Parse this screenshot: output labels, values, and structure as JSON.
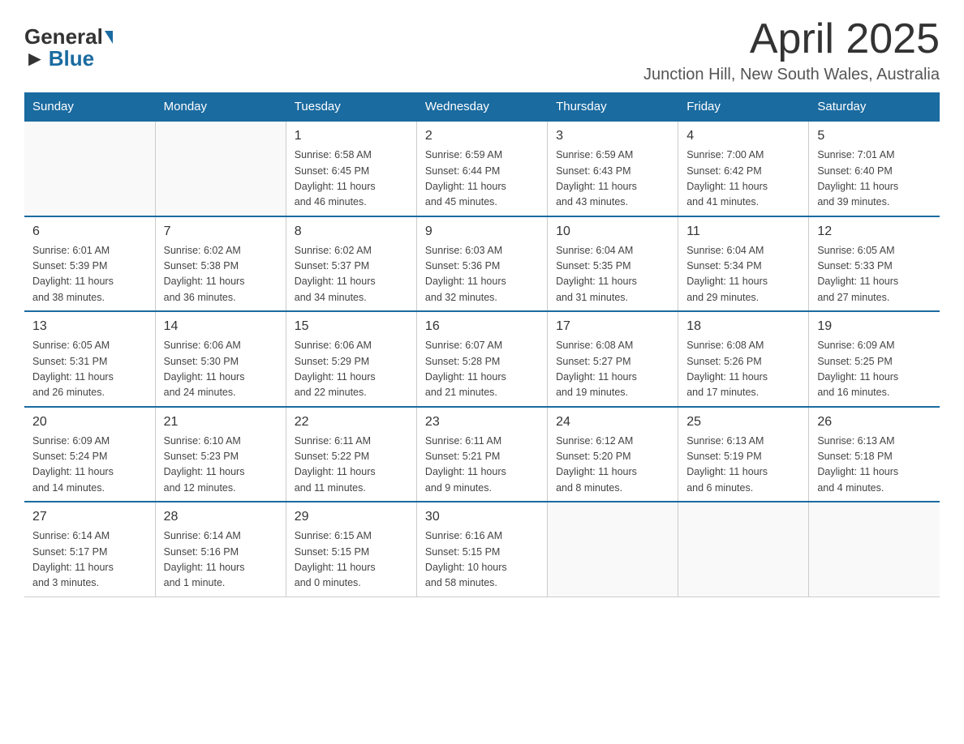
{
  "header": {
    "title": "April 2025",
    "subtitle": "Junction Hill, New South Wales, Australia"
  },
  "logo": {
    "part1": "General",
    "part2": "Blue"
  },
  "days_of_week": [
    "Sunday",
    "Monday",
    "Tuesday",
    "Wednesday",
    "Thursday",
    "Friday",
    "Saturday"
  ],
  "weeks": [
    [
      {
        "day": "",
        "info": ""
      },
      {
        "day": "",
        "info": ""
      },
      {
        "day": "1",
        "info": "Sunrise: 6:58 AM\nSunset: 6:45 PM\nDaylight: 11 hours\nand 46 minutes."
      },
      {
        "day": "2",
        "info": "Sunrise: 6:59 AM\nSunset: 6:44 PM\nDaylight: 11 hours\nand 45 minutes."
      },
      {
        "day": "3",
        "info": "Sunrise: 6:59 AM\nSunset: 6:43 PM\nDaylight: 11 hours\nand 43 minutes."
      },
      {
        "day": "4",
        "info": "Sunrise: 7:00 AM\nSunset: 6:42 PM\nDaylight: 11 hours\nand 41 minutes."
      },
      {
        "day": "5",
        "info": "Sunrise: 7:01 AM\nSunset: 6:40 PM\nDaylight: 11 hours\nand 39 minutes."
      }
    ],
    [
      {
        "day": "6",
        "info": "Sunrise: 6:01 AM\nSunset: 5:39 PM\nDaylight: 11 hours\nand 38 minutes."
      },
      {
        "day": "7",
        "info": "Sunrise: 6:02 AM\nSunset: 5:38 PM\nDaylight: 11 hours\nand 36 minutes."
      },
      {
        "day": "8",
        "info": "Sunrise: 6:02 AM\nSunset: 5:37 PM\nDaylight: 11 hours\nand 34 minutes."
      },
      {
        "day": "9",
        "info": "Sunrise: 6:03 AM\nSunset: 5:36 PM\nDaylight: 11 hours\nand 32 minutes."
      },
      {
        "day": "10",
        "info": "Sunrise: 6:04 AM\nSunset: 5:35 PM\nDaylight: 11 hours\nand 31 minutes."
      },
      {
        "day": "11",
        "info": "Sunrise: 6:04 AM\nSunset: 5:34 PM\nDaylight: 11 hours\nand 29 minutes."
      },
      {
        "day": "12",
        "info": "Sunrise: 6:05 AM\nSunset: 5:33 PM\nDaylight: 11 hours\nand 27 minutes."
      }
    ],
    [
      {
        "day": "13",
        "info": "Sunrise: 6:05 AM\nSunset: 5:31 PM\nDaylight: 11 hours\nand 26 minutes."
      },
      {
        "day": "14",
        "info": "Sunrise: 6:06 AM\nSunset: 5:30 PM\nDaylight: 11 hours\nand 24 minutes."
      },
      {
        "day": "15",
        "info": "Sunrise: 6:06 AM\nSunset: 5:29 PM\nDaylight: 11 hours\nand 22 minutes."
      },
      {
        "day": "16",
        "info": "Sunrise: 6:07 AM\nSunset: 5:28 PM\nDaylight: 11 hours\nand 21 minutes."
      },
      {
        "day": "17",
        "info": "Sunrise: 6:08 AM\nSunset: 5:27 PM\nDaylight: 11 hours\nand 19 minutes."
      },
      {
        "day": "18",
        "info": "Sunrise: 6:08 AM\nSunset: 5:26 PM\nDaylight: 11 hours\nand 17 minutes."
      },
      {
        "day": "19",
        "info": "Sunrise: 6:09 AM\nSunset: 5:25 PM\nDaylight: 11 hours\nand 16 minutes."
      }
    ],
    [
      {
        "day": "20",
        "info": "Sunrise: 6:09 AM\nSunset: 5:24 PM\nDaylight: 11 hours\nand 14 minutes."
      },
      {
        "day": "21",
        "info": "Sunrise: 6:10 AM\nSunset: 5:23 PM\nDaylight: 11 hours\nand 12 minutes."
      },
      {
        "day": "22",
        "info": "Sunrise: 6:11 AM\nSunset: 5:22 PM\nDaylight: 11 hours\nand 11 minutes."
      },
      {
        "day": "23",
        "info": "Sunrise: 6:11 AM\nSunset: 5:21 PM\nDaylight: 11 hours\nand 9 minutes."
      },
      {
        "day": "24",
        "info": "Sunrise: 6:12 AM\nSunset: 5:20 PM\nDaylight: 11 hours\nand 8 minutes."
      },
      {
        "day": "25",
        "info": "Sunrise: 6:13 AM\nSunset: 5:19 PM\nDaylight: 11 hours\nand 6 minutes."
      },
      {
        "day": "26",
        "info": "Sunrise: 6:13 AM\nSunset: 5:18 PM\nDaylight: 11 hours\nand 4 minutes."
      }
    ],
    [
      {
        "day": "27",
        "info": "Sunrise: 6:14 AM\nSunset: 5:17 PM\nDaylight: 11 hours\nand 3 minutes."
      },
      {
        "day": "28",
        "info": "Sunrise: 6:14 AM\nSunset: 5:16 PM\nDaylight: 11 hours\nand 1 minute."
      },
      {
        "day": "29",
        "info": "Sunrise: 6:15 AM\nSunset: 5:15 PM\nDaylight: 11 hours\nand 0 minutes."
      },
      {
        "day": "30",
        "info": "Sunrise: 6:16 AM\nSunset: 5:15 PM\nDaylight: 10 hours\nand 58 minutes."
      },
      {
        "day": "",
        "info": ""
      },
      {
        "day": "",
        "info": ""
      },
      {
        "day": "",
        "info": ""
      }
    ]
  ]
}
